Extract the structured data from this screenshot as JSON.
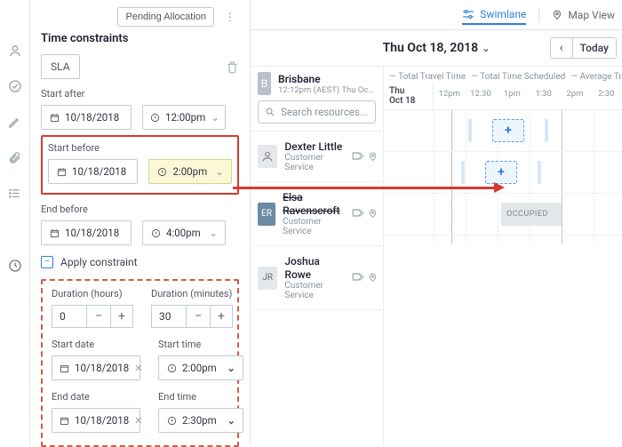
{
  "header": {
    "pending_allocation_label": "Pending Allocation"
  },
  "constraints": {
    "title": "Time constraints",
    "sla_label": "SLA",
    "start_after_label": "Start after",
    "start_after_date": "10/18/2018",
    "start_after_time": "12:00pm",
    "start_before_label": "Start before",
    "start_before_date": "10/18/2018",
    "start_before_time": "2:00pm",
    "end_before_label": "End before",
    "end_before_date": "10/18/2018",
    "end_before_time": "4:00pm",
    "apply_label": "Apply constraint"
  },
  "duration": {
    "hours_label": "Duration (hours)",
    "hours_value": "0",
    "minutes_label": "Duration (minutes)",
    "minutes_value": "30",
    "start_date_label": "Start date",
    "start_date_value": "10/18/2018",
    "start_time_label": "Start time",
    "start_time_value": "2:00pm",
    "end_date_label": "End date",
    "end_date_value": "10/18/2018",
    "end_time_label": "End time",
    "end_time_value": "2:30pm"
  },
  "views": {
    "swimlane_label": "Swimlane",
    "map_label": "Map View"
  },
  "datebar": {
    "current_date": "Thu Oct 18, 2018",
    "today_label": "Today"
  },
  "region": {
    "name": "Brisbane",
    "sub": "12:12pm (AEST) Thu Oct 18, 20…",
    "avatar": "B"
  },
  "search": {
    "placeholder": "Search resources..."
  },
  "timeline": {
    "meta1": "Total Travel Time",
    "meta2": "Total Time Scheduled",
    "meta3": "Average Tr",
    "day_head_line1": "Thu",
    "day_head_line2": "Oct 18",
    "ticks": [
      "12pm",
      "12:30",
      "1pm",
      "1:30",
      "2pm",
      "2:30"
    ]
  },
  "resources": [
    {
      "name": "Dexter Little",
      "role": "Customer Service",
      "avatar": "",
      "selected": false,
      "strike": false
    },
    {
      "name": "Elsa Ravenscroft",
      "role": "Customer Service",
      "avatar": "ER",
      "selected": true,
      "strike": true
    },
    {
      "name": "Joshua Rowe",
      "role": "Customer Service",
      "avatar": "JR",
      "selected": false,
      "strike": false
    }
  ],
  "occupied_label": "OCCUPIED"
}
